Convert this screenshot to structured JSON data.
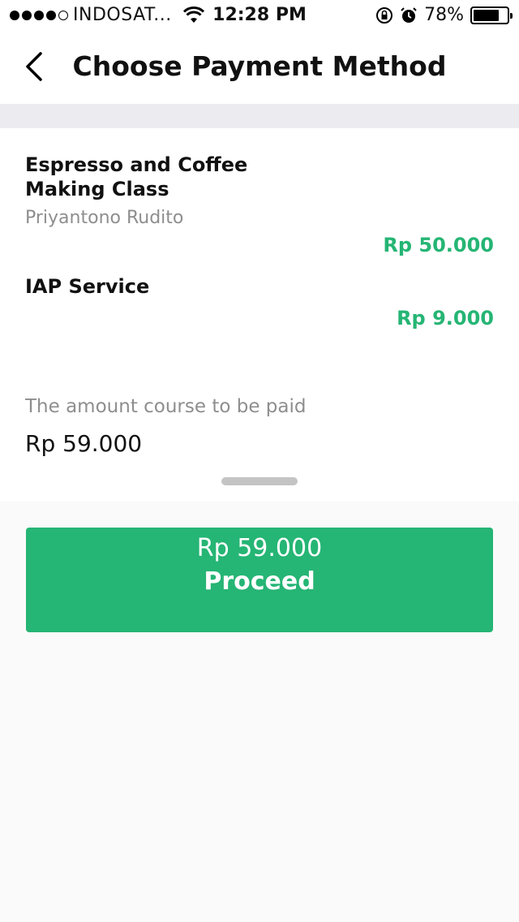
{
  "status_bar": {
    "carrier": "INDOSAT...",
    "time": "12:28 PM",
    "battery_percent": "78%",
    "battery_level": 0.78,
    "icons": [
      "wifi-icon",
      "rotation-lock-icon",
      "alarm-icon",
      "battery-icon"
    ]
  },
  "header": {
    "title": "Choose Payment Method",
    "back_icon": "chevron-left-icon"
  },
  "order_items": [
    {
      "title": "Espresso and Coffee Making Class",
      "subtitle": "Priyantono Rudito",
      "price": "Rp 50.000"
    },
    {
      "title": "IAP Service",
      "subtitle": "",
      "price": "Rp 9.000"
    }
  ],
  "summary": {
    "label": "The amount course to be paid",
    "total": "Rp 59.000"
  },
  "proceed_button": {
    "amount": "Rp 59.000",
    "label": "Proceed"
  },
  "colors": {
    "accent": "#25b574",
    "muted_text": "#8e8e8e",
    "band": "#ececf0"
  }
}
